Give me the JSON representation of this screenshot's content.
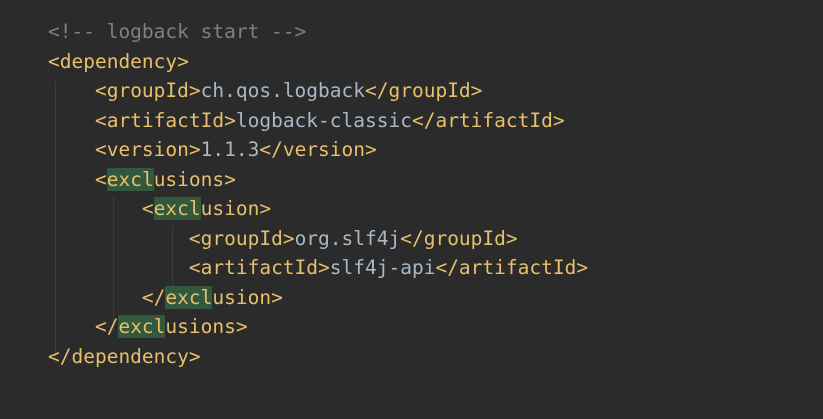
{
  "editor": {
    "lines": [
      {
        "comment": "<!-- logback start -->"
      },
      {
        "open": "<dependency>"
      },
      {
        "open": "<groupId>",
        "text": "ch.qos.logback",
        "close": "</groupId>"
      },
      {
        "open": "<artifactId>",
        "text": "logback-classic",
        "close": "</artifactId>"
      },
      {
        "open": "<version>",
        "text": "1.1.3",
        "close": "</version>"
      },
      {
        "pre": "<",
        "match": "excl",
        "post": "usions>"
      },
      {
        "pre": "<",
        "match": "excl",
        "post": "usion>"
      },
      {
        "open": "<groupId>",
        "text": "org.slf4j",
        "close": "</groupId>"
      },
      {
        "open": "<artifactId>",
        "text": "slf4j-api",
        "close": "</artifactId>"
      },
      {
        "pre": "</",
        "match": "excl",
        "post": "usion>"
      },
      {
        "pre": "</",
        "match": "excl",
        "post": "usions>"
      },
      {
        "open": "</dependency>"
      }
    ],
    "colors": {
      "background": "#2b2b2b",
      "tag": "#e8bf6a",
      "text": "#a9b7c6",
      "comment": "#808080",
      "match_highlight": "#32593d"
    }
  }
}
